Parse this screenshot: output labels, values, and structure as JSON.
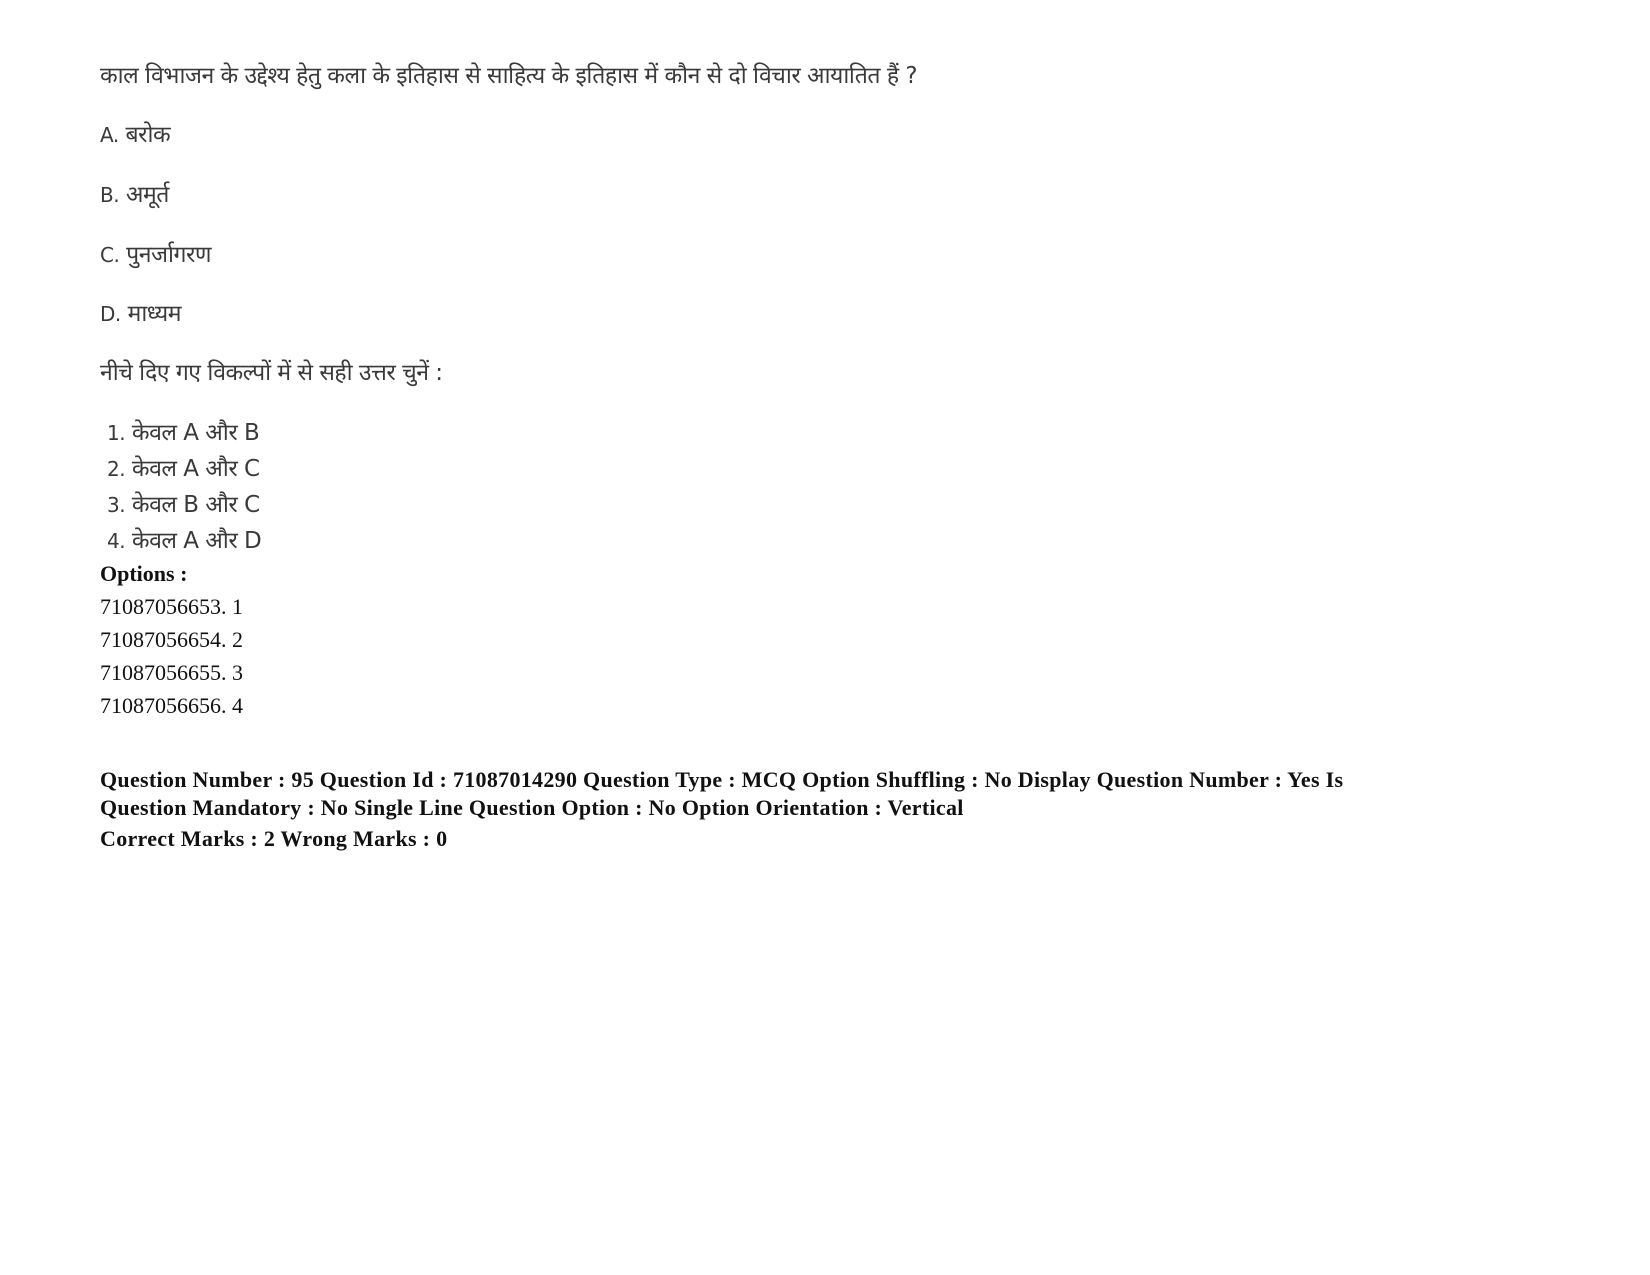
{
  "question": {
    "text": "काल विभाजन के उद्देश्य हेतु कला के इतिहास से साहित्य के इतिहास में कौन से दो विचार आयातित हैं ?",
    "statements": [
      {
        "label": "A.",
        "text": "बरोक"
      },
      {
        "label": "B.",
        "text": "अमूर्त"
      },
      {
        "label": "C.",
        "text": "पुनर्जागरण"
      },
      {
        "label": "D.",
        "text": "माध्यम"
      }
    ],
    "instruction": "नीचे दिए गए विकल्पों में से सही उत्तर चुनें :",
    "choices": [
      {
        "num": "1.",
        "text": "केवल A और B"
      },
      {
        "num": "2.",
        "text": "केवल A और C"
      },
      {
        "num": "3.",
        "text": "केवल B और C"
      },
      {
        "num": "4.",
        "text": "केवल A और D"
      }
    ]
  },
  "options": {
    "heading": "Options :",
    "items": [
      "71087056653. 1",
      "71087056654. 2",
      "71087056655. 3",
      "71087056656. 4"
    ]
  },
  "meta": {
    "line": "Question Number : 95 Question Id : 71087014290 Question Type : MCQ Option Shuffling : No Display Question Number : Yes Is Question Mandatory : No Single Line Question Option : No Option Orientation : Vertical",
    "marks": "Correct Marks : 2 Wrong Marks : 0"
  }
}
